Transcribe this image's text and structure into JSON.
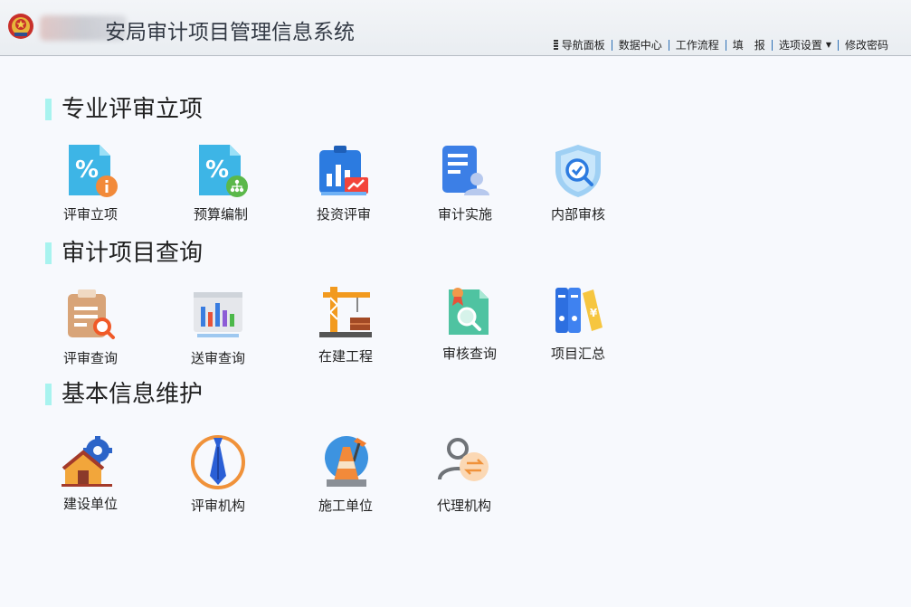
{
  "header": {
    "title": "安局审计项目管理信息系统"
  },
  "topnav": [
    {
      "label": "导航面板"
    },
    {
      "label": "数据中心"
    },
    {
      "label": "工作流程"
    },
    {
      "label": "填　报"
    },
    {
      "label": "选项设置"
    },
    {
      "label": "修改密码"
    }
  ],
  "sections": [
    {
      "title": "专业评审立项",
      "items": [
        {
          "label": "评审立项"
        },
        {
          "label": "预算编制"
        },
        {
          "label": "投资评审"
        },
        {
          "label": "审计实施"
        },
        {
          "label": "内部审核"
        }
      ]
    },
    {
      "title": "审计项目查询",
      "items": [
        {
          "label": "评审查询"
        },
        {
          "label": "送审查询"
        },
        {
          "label": "在建工程"
        },
        {
          "label": "审核查询"
        },
        {
          "label": "项目汇总"
        }
      ]
    },
    {
      "title": "基本信息维护",
      "items": [
        {
          "label": "建设单位"
        },
        {
          "label": "评审机构"
        },
        {
          "label": "施工单位"
        },
        {
          "label": "代理机构"
        }
      ]
    }
  ]
}
